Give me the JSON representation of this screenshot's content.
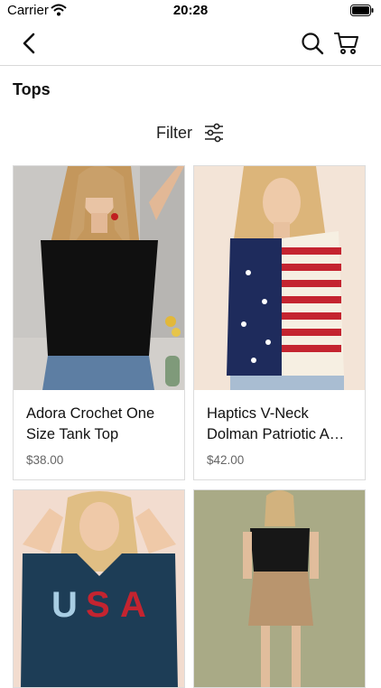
{
  "status_bar": {
    "carrier": "Carrier",
    "time": "20:28"
  },
  "nav": {
    "back_icon": "chevron-left-icon",
    "search_icon": "search-icon",
    "cart_icon": "cart-icon"
  },
  "page": {
    "title": "Tops"
  },
  "filter": {
    "label": "Filter",
    "icon": "sliders-icon"
  },
  "products": [
    {
      "name": "Adora Crochet One Size Tank Top",
      "price": "$38.00"
    },
    {
      "name": "Haptics V-Neck Dolman Patriotic A…",
      "price": "$42.00"
    },
    {
      "name": "",
      "price": ""
    },
    {
      "name": "",
      "price": ""
    }
  ],
  "colors": {
    "accent": "#111111",
    "divider": "#d8d8d8",
    "price": "#666666"
  }
}
